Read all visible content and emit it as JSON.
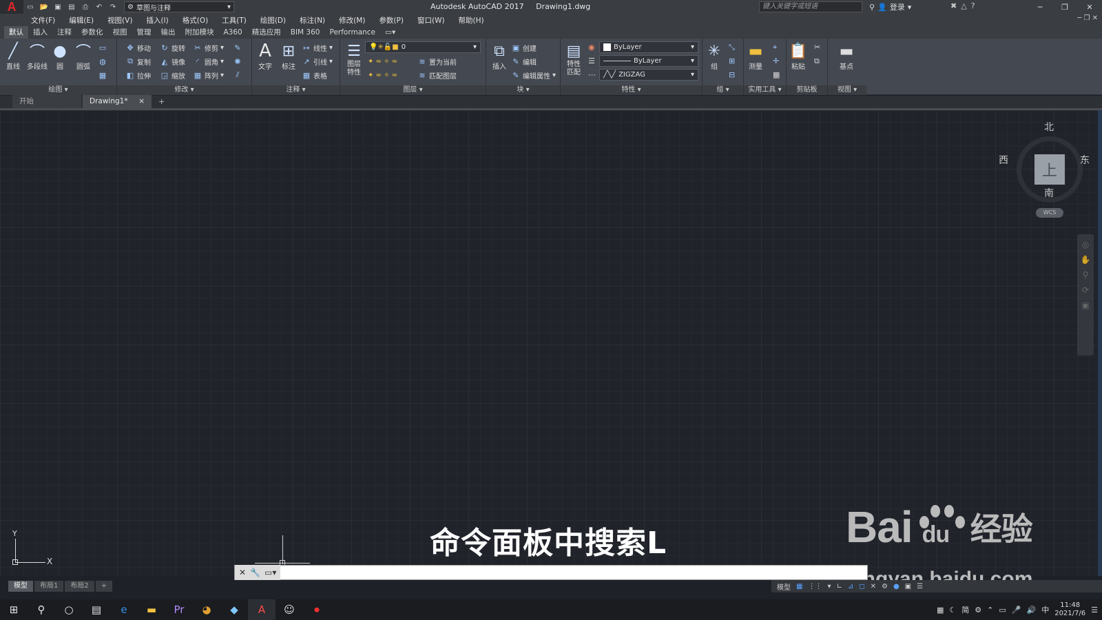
{
  "title_bar": {
    "app_logo": "A",
    "workspace": "草图与注释",
    "app_name": "Autodesk AutoCAD 2017",
    "file_name": "Drawing1.dwg",
    "search_placeholder": "键入关键字或短语",
    "signin_label": "登录"
  },
  "menu": {
    "items": [
      "文件(F)",
      "编辑(E)",
      "视图(V)",
      "插入(I)",
      "格式(O)",
      "工具(T)",
      "绘图(D)",
      "标注(N)",
      "修改(M)",
      "参数(P)",
      "窗口(W)",
      "帮助(H)"
    ]
  },
  "ribbon_tabs": {
    "items": [
      "默认",
      "插入",
      "注释",
      "参数化",
      "视图",
      "管理",
      "输出",
      "附加模块",
      "A360",
      "精选应用",
      "BIM 360",
      "Performance"
    ]
  },
  "ribbon": {
    "draw": {
      "title": "绘图 ▾",
      "line": "直线",
      "polyline": "多段线",
      "circle": "圆",
      "arc": "圆弧"
    },
    "modify": {
      "title": "修改 ▾",
      "move": "移动",
      "rotate": "旋转",
      "trim": "修剪",
      "copy": "复制",
      "mirror": "镜像",
      "fillet": "圆角",
      "stretch": "拉伸",
      "scale": "缩放",
      "array": "阵列"
    },
    "annotation": {
      "title": "注释 ▾",
      "text": "文字",
      "dimension": "标注",
      "linear": "线性",
      "leader": "引线",
      "table": "表格"
    },
    "layers": {
      "title": "图层 ▾",
      "layer_props": "图层特性",
      "current_layer": "0",
      "set_current": "置为当前",
      "match_layer": "匹配图层"
    },
    "block": {
      "title": "块 ▾",
      "insert": "插入",
      "create": "创建",
      "edit": "编辑",
      "edit_attr": "编辑属性"
    },
    "properties": {
      "title": "特性 ▾",
      "match": "特性匹配",
      "color": "ByLayer",
      "lineweight": "ByLayer",
      "linetype": "ZIGZAG"
    },
    "groups": {
      "title": "组 ▾",
      "group": "组"
    },
    "utilities": {
      "title": "实用工具 ▾",
      "measure": "测量"
    },
    "clipboard": {
      "title": "剪贴板",
      "paste": "粘贴"
    },
    "view": {
      "title": "视图 ▾",
      "base": "基点"
    }
  },
  "doc_tabs": {
    "start": "开始",
    "drawing": "Drawing1*"
  },
  "viewcube": {
    "north": "北",
    "south": "南",
    "east": "东",
    "west": "西",
    "top": "上",
    "wcs": "WCS"
  },
  "ucs": {
    "x": "X",
    "y": "Y"
  },
  "caption": "命令面板中搜索L",
  "watermark": {
    "brand_left": "Bai",
    "brand_mid": "du",
    "brand_right": "经验",
    "url": "jingyan.baidu.com"
  },
  "command_line": {
    "value": "",
    "placeholder": ""
  },
  "layout_tabs": {
    "items": [
      "模型",
      "布局1",
      "布局2"
    ]
  },
  "status_bar": {
    "model_label": "模型"
  },
  "taskbar": {
    "time": "11:48",
    "date": "2021/7/6",
    "ime": "中",
    "ime2": "简"
  }
}
